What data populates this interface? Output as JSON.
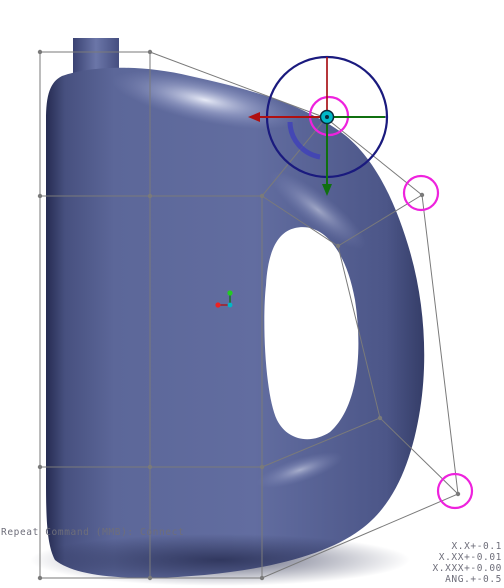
{
  "status": {
    "command_hint": "Repeat Command (MMB): Connect"
  },
  "tolerances": {
    "lines": [
      "X.X+-0.1",
      "X.XX+-0.01",
      "X.XXX+-0.00",
      "ANG.+-0.5"
    ]
  },
  "colors": {
    "body": "#5c6799",
    "highlight": "#dfe4f6",
    "cage": "#7a7a7a",
    "selection": "#ee22dd",
    "manipulator_ring": "#1a1a7e",
    "axis_x": "#b01010",
    "axis_y": "#107010",
    "axis_z": "#00b8c8"
  },
  "icons": [
    "manipulator-icon",
    "triad-icon"
  ]
}
